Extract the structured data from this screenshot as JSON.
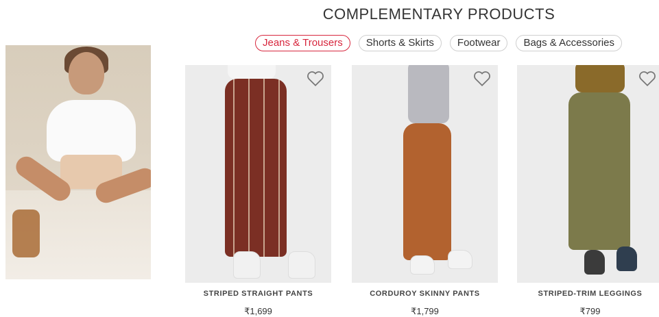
{
  "section": {
    "title": "COMPLEMENTARY PRODUCTS"
  },
  "tabs": [
    {
      "label": "Jeans & Trousers",
      "active": true
    },
    {
      "label": "Shorts & Skirts",
      "active": false
    },
    {
      "label": "Footwear",
      "active": false
    },
    {
      "label": "Bags & Accessories",
      "active": false
    }
  ],
  "hero": {
    "icon": "model-photo"
  },
  "products": [
    {
      "name": "STRIPED STRAIGHT PANTS",
      "price": "₹1,699",
      "color": "#7b2f24",
      "icon": "heart-icon"
    },
    {
      "name": "CORDUROY SKINNY PANTS",
      "price": "₹1,799",
      "color": "#b2622f",
      "icon": "heart-icon"
    },
    {
      "name": "STRIPED-TRIM LEGGINGS",
      "price": "₹799",
      "color": "#7c7a4b",
      "icon": "heart-icon"
    }
  ],
  "colors": {
    "accent": "#d7263d",
    "text": "#333333",
    "border": "#cfcfcf"
  }
}
